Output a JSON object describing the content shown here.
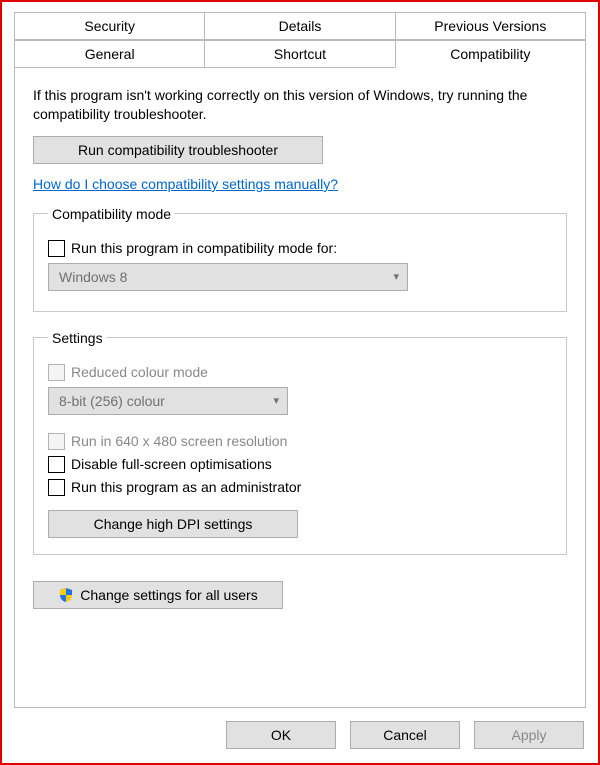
{
  "tabs": {
    "row1": [
      "Security",
      "Details",
      "Previous Versions"
    ],
    "row2": [
      "General",
      "Shortcut",
      "Compatibility"
    ],
    "active": "Compatibility"
  },
  "intro": "If this program isn't working correctly on this version of Windows, try running the compatibility troubleshooter.",
  "troubleshoot_btn": "Run compatibility troubleshooter",
  "help_link": "How do I choose compatibility settings manually?",
  "compat_mode": {
    "legend": "Compatibility mode",
    "checkbox_label": "Run this program in compatibility mode for:",
    "combo_value": "Windows 8"
  },
  "settings": {
    "legend": "Settings",
    "reduced_colour_label": "Reduced colour mode",
    "colour_combo_value": "8-bit (256) colour",
    "run_640_label": "Run in 640 x 480 screen resolution",
    "disable_fullscreen_label": "Disable full-screen optimisations",
    "run_admin_label": "Run this program as an administrator",
    "dpi_btn": "Change high DPI settings"
  },
  "all_users_btn": "Change settings for all users",
  "footer": {
    "ok": "OK",
    "cancel": "Cancel",
    "apply": "Apply"
  }
}
